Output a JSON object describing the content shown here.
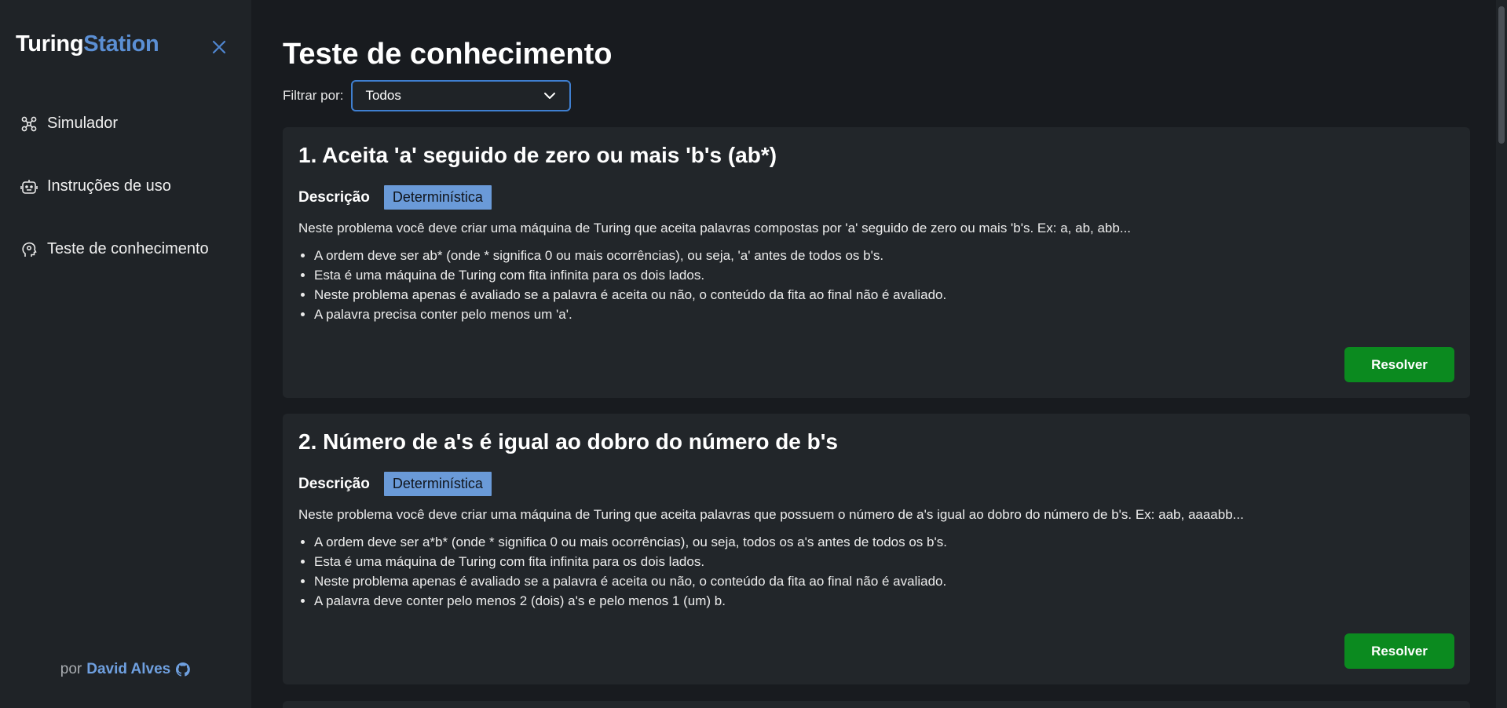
{
  "brand": {
    "part1": "Turing",
    "part2": "Station"
  },
  "sidebar": {
    "items": [
      {
        "label": "Simulador",
        "icon": "graph-nodes-icon"
      },
      {
        "label": "Instruções de uso",
        "icon": "robot-face-icon"
      },
      {
        "label": "Teste de conhecimento",
        "icon": "brain-head-icon"
      }
    ],
    "footer": {
      "prefix": "por",
      "author": "David Alves",
      "icon": "github-icon"
    }
  },
  "main": {
    "title": "Teste de conhecimento",
    "filter": {
      "label": "Filtrar por:",
      "selected": "Todos"
    },
    "problems": [
      {
        "title": "1. Aceita 'a' seguido de zero ou mais 'b's (ab*)",
        "desc_label": "Descrição",
        "badge": "Determinística",
        "lead": "Neste problema você deve criar uma máquina de Turing que aceita palavras compostas por 'a' seguido de zero ou mais 'b's. Ex: a, ab, abb...",
        "rules": [
          "A ordem deve ser ab* (onde * significa 0 ou mais ocorrências), ou seja, 'a' antes de todos os b's.",
          "Esta é uma máquina de Turing com fita infinita para os dois lados.",
          "Neste problema apenas é avaliado se a palavra é aceita ou não, o conteúdo da fita ao final não é avaliado.",
          "A palavra precisa conter pelo menos um 'a'."
        ],
        "button": "Resolver"
      },
      {
        "title": "2. Número de a's é igual ao dobro do número de b's",
        "desc_label": "Descrição",
        "badge": "Determinística",
        "lead": "Neste problema você deve criar uma máquina de Turing que aceita palavras que possuem o número de a's igual ao dobro do número de b's. Ex: aab, aaaabb...",
        "rules": [
          "A ordem deve ser a*b* (onde * significa 0 ou mais ocorrências), ou seja, todos os a's antes de todos os b's.",
          "Esta é uma máquina de Turing com fita infinita para os dois lados.",
          "Neste problema apenas é avaliado se a palavra é aceita ou não, o conteúdo da fita ao final não é avaliado.",
          "A palavra deve conter pelo menos 2 (dois) a's e pelo menos 1 (um) b."
        ],
        "button": "Resolver"
      }
    ]
  },
  "colors": {
    "background": "#181b1f",
    "sidebar": "#1f2327",
    "card": "#22262a",
    "accent": "#5b8fd4",
    "badge": "#6a9ad8",
    "button": "#0b8a1f"
  }
}
